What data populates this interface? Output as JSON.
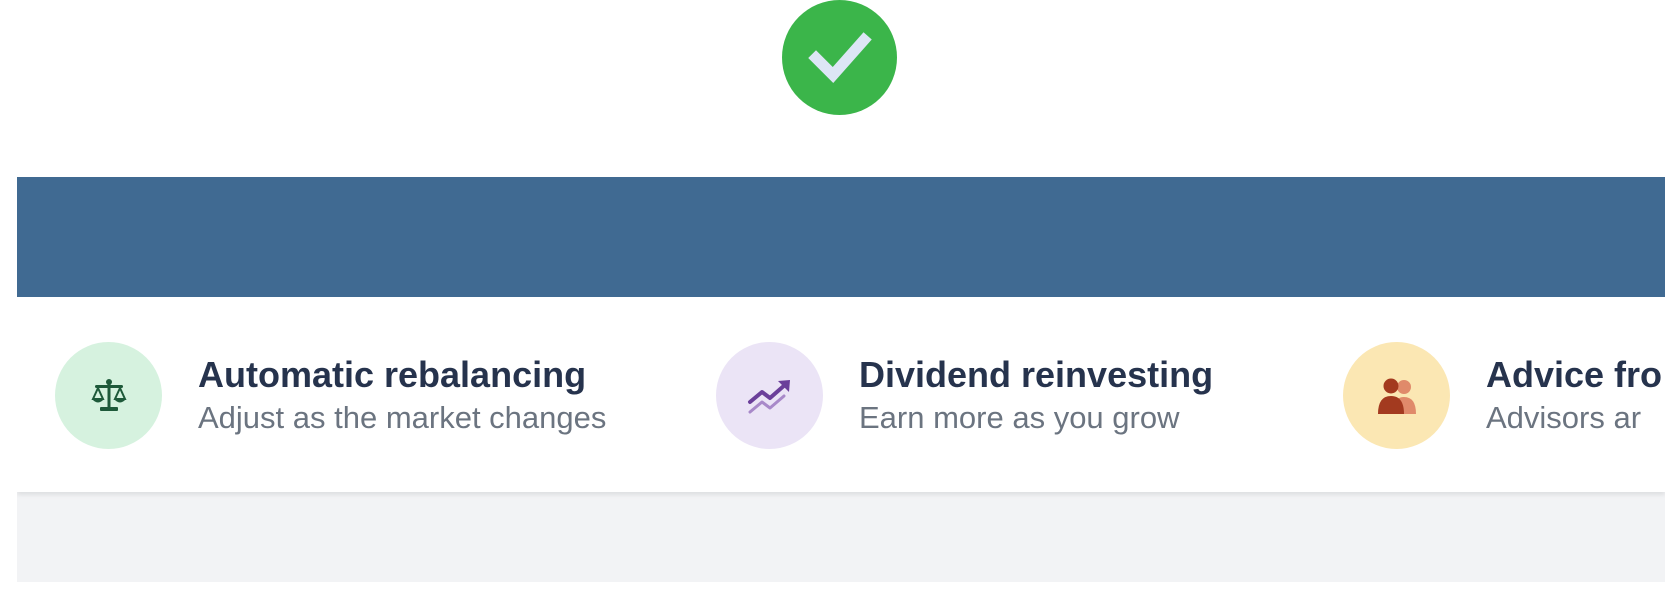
{
  "status": {
    "icon": "checkmark-icon",
    "color": "#3bb54a"
  },
  "banner": {
    "color": "#406a92"
  },
  "features": [
    {
      "icon": "scales-icon",
      "icon_bg": "#d6f2df",
      "title": "Automatic rebalancing",
      "subtitle": "Adjust as the market changes"
    },
    {
      "icon": "trending-up-icon",
      "icon_bg": "#ebe4f6",
      "title": "Dividend reinvesting",
      "subtitle": "Earn more as you grow"
    },
    {
      "icon": "people-icon",
      "icon_bg": "#fbe7b3",
      "title": "Advice fro",
      "subtitle": "Advisors ar"
    }
  ]
}
